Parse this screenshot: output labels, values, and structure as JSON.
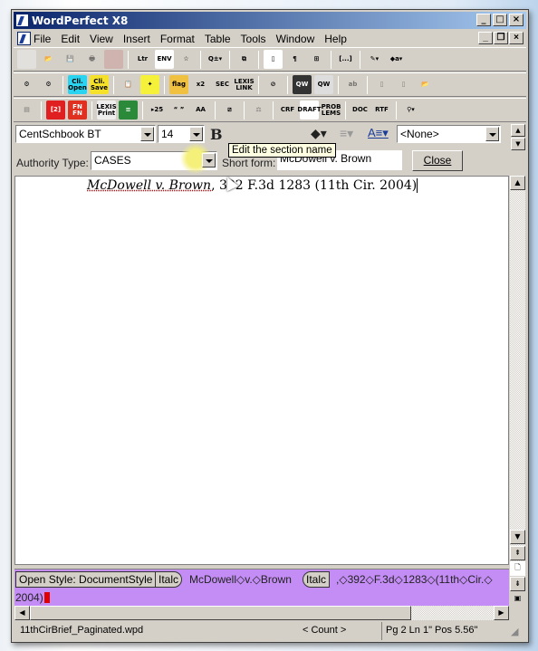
{
  "window": {
    "title": "WordPerfect X8",
    "controls": [
      "_",
      "□",
      "×"
    ],
    "doc_controls": [
      "_",
      "❐",
      "×"
    ]
  },
  "menu": [
    "File",
    "Edit",
    "View",
    "Insert",
    "Format",
    "Table",
    "Tools",
    "Window",
    "Help"
  ],
  "toolbar1": [
    {
      "icon": "new-doc-icon",
      "label": "",
      "bg": "#f4f4f4",
      "dis": true
    },
    {
      "icon": "open-folder-icon",
      "label": "📂",
      "bg": ""
    },
    {
      "icon": "save-icon",
      "label": "💾",
      "bg": "",
      "dis": true
    },
    {
      "icon": "print-icon",
      "label": "🖶",
      "bg": "",
      "dis": true
    },
    {
      "icon": "fax-icon",
      "label": "",
      "bg": "#c89090",
      "dis": true
    },
    {
      "sep": true
    },
    {
      "icon": "letter-icon",
      "label": "Ltr",
      "bg": ""
    },
    {
      "icon": "envelope-icon",
      "label": "ENV",
      "bg": "#fff"
    },
    {
      "icon": "star-icon",
      "label": "☆",
      "bg": ""
    },
    {
      "sep": true
    },
    {
      "icon": "zoom-icon",
      "label": "Q±▾",
      "bg": ""
    },
    {
      "sep": true
    },
    {
      "icon": "page-view-icon",
      "label": "⧉",
      "bg": ""
    },
    {
      "sep": true
    },
    {
      "icon": "page-border-icon",
      "label": "▯",
      "bg": "#fff"
    },
    {
      "icon": "paragraph-icon",
      "label": "¶",
      "bg": ""
    },
    {
      "icon": "insert-page-icon",
      "label": "⊞",
      "bg": ""
    },
    {
      "sep": true
    },
    {
      "icon": "bracket-icon",
      "label": "[...]",
      "bg": ""
    },
    {
      "sep": true
    },
    {
      "icon": "highlight-icon",
      "label": "✎▾",
      "bg": ""
    },
    {
      "icon": "fill-icon",
      "label": "◆a▾",
      "bg": ""
    }
  ],
  "toolbar2": [
    {
      "icon": "template-icon",
      "label": "⚙",
      "bg": ""
    },
    {
      "icon": "template2-icon",
      "label": "⚙",
      "bg": ""
    },
    {
      "sep": true
    },
    {
      "icon": "cli-open-icon",
      "label": "Cli. Open",
      "bg": "#2ad4f0"
    },
    {
      "icon": "cli-save-icon",
      "label": "Cli. Save",
      "bg": "#f5e02a"
    },
    {
      "sep": true
    },
    {
      "icon": "clipboard-icon",
      "label": "📋",
      "bg": ""
    },
    {
      "icon": "tool-icon",
      "label": "✦",
      "bg": "#f5f03a"
    },
    {
      "sep": true
    },
    {
      "icon": "flag-icon",
      "label": "flag",
      "bg": "#f0c040"
    },
    {
      "icon": "toc-icon",
      "label": "x2",
      "bg": ""
    },
    {
      "icon": "section-icon",
      "label": "SEC",
      "bg": ""
    },
    {
      "icon": "lexis-link-icon",
      "label": "LEXIS LINK",
      "bg": ""
    },
    {
      "sep": true
    },
    {
      "icon": "no-icon",
      "label": "⊘",
      "bg": ""
    },
    {
      "sep": true
    },
    {
      "icon": "qw-icon",
      "label": "QW",
      "bg": "#333"
    },
    {
      "icon": "qw-ok-icon",
      "label": "QW",
      "bg": "#ddd"
    },
    {
      "sep": true
    },
    {
      "icon": "ab-icon",
      "label": "ab",
      "bg": "",
      "dis": true
    },
    {
      "sep": true
    },
    {
      "icon": "doc1-icon",
      "label": "▯",
      "bg": "",
      "dis": true
    },
    {
      "icon": "doc2-icon",
      "label": "▯",
      "bg": "",
      "dis": true
    },
    {
      "icon": "folder-export-icon",
      "label": "📂",
      "bg": ""
    }
  ],
  "toolbar3": [
    {
      "icon": "book-icon",
      "label": "▤",
      "bg": "",
      "dis": true
    },
    {
      "sep": true
    },
    {
      "icon": "footnote-icon",
      "label": "[2]",
      "bg": "#e02020"
    },
    {
      "icon": "fn-fn-icon",
      "label": "FN FN",
      "bg": "#e03020"
    },
    {
      "sep": true
    },
    {
      "icon": "lexis-print-icon",
      "label": "LEXIS Print",
      "bg": "#eee"
    },
    {
      "icon": "green-form-icon",
      "label": "≡",
      "bg": "#2a8a3a"
    },
    {
      "sep": true
    },
    {
      "icon": "section-25-icon",
      "label": "▸25",
      "bg": ""
    },
    {
      "icon": "quotes-icon",
      "label": "“ ”",
      "bg": ""
    },
    {
      "icon": "aa-icon",
      "label": "AA",
      "bg": ""
    },
    {
      "sep": true
    },
    {
      "icon": "compare-icon",
      "label": "⧄",
      "bg": ""
    },
    {
      "sep": true
    },
    {
      "icon": "scales-icon",
      "label": "⚖",
      "bg": "",
      "dis": true
    },
    {
      "sep": true
    },
    {
      "icon": "crf-icon",
      "label": "CRF",
      "bg": ""
    },
    {
      "icon": "draft-icon",
      "label": "DRAFT",
      "bg": "#fff"
    },
    {
      "icon": "problems-icon",
      "label": "PROB LEMS",
      "bg": ""
    },
    {
      "sep": true
    },
    {
      "icon": "doc-export-icon",
      "label": "DOC",
      "bg": ""
    },
    {
      "icon": "rtf-export-icon",
      "label": "RTF",
      "bg": ""
    },
    {
      "sep": true
    },
    {
      "icon": "rocket-icon",
      "label": "⚲▾",
      "bg": ""
    }
  ],
  "format": {
    "font": "CentSchbook BT",
    "size": "14",
    "bold": "B",
    "italic": "I",
    "underline": "U",
    "style": "<None>"
  },
  "authority": {
    "type_label": "Authority Type:",
    "type_value": "CASES",
    "short_label": "Short form:",
    "short_value": "McDowell v. Brown",
    "close": "Close"
  },
  "tooltip": "Edit the section name",
  "document": {
    "case_name": "McDowell v. Brown",
    "citation": ", 392 F.3d 1283 (11th Cir. 2004)"
  },
  "reveal": {
    "open_style": "Open Style: DocumentStyle",
    "italc_on": "Italc",
    "text1": "McDowell◇v.◇Brown",
    "italc_off": "Italc",
    "text2": ",◇392◇F.3d◇1283◇(11th◇Cir.◇",
    "text3": "2004)"
  },
  "status": {
    "filename": "11thCirBrief_Paginated.wpd",
    "count": "< Count >",
    "position": "Pg 2 Ln 1\" Pos 5.56\""
  },
  "colors": {
    "reveal_bg": "#c48df5",
    "title_bar": "#0a246a",
    "cursor_code": "#e00000"
  }
}
